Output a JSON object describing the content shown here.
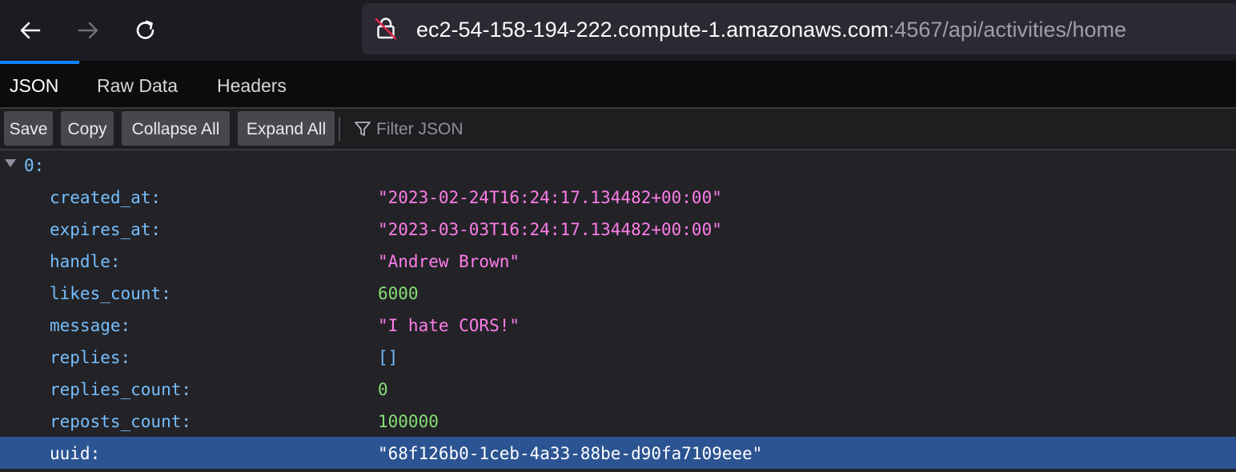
{
  "address_bar": {
    "host": "ec2-54-158-194-222.compute-1.amazonaws.com",
    "path": ":4567/api/activities/home"
  },
  "tabs": [
    {
      "label": "JSON",
      "selected": true
    },
    {
      "label": "Raw Data",
      "selected": false
    },
    {
      "label": "Headers",
      "selected": false
    }
  ],
  "toolbar": {
    "save": "Save",
    "copy": "Copy",
    "collapse_all": "Collapse All",
    "expand_all": "Expand All",
    "filter_placeholder": "Filter JSON"
  },
  "tree": {
    "root_key": "0:",
    "rows": [
      {
        "key": "created_at:",
        "value": "\"2023-02-24T16:24:17.134482+00:00\"",
        "type": "string"
      },
      {
        "key": "expires_at:",
        "value": "\"2023-03-03T16:24:17.134482+00:00\"",
        "type": "string"
      },
      {
        "key": "handle:",
        "value": "\"Andrew Brown\"",
        "type": "string"
      },
      {
        "key": "likes_count:",
        "value": "6000",
        "type": "number"
      },
      {
        "key": "message:",
        "value": "\"I hate CORS!\"",
        "type": "string"
      },
      {
        "key": "replies:",
        "value": "[]",
        "type": "array"
      },
      {
        "key": "replies_count:",
        "value": "0",
        "type": "number"
      },
      {
        "key": "reposts_count:",
        "value": "100000",
        "type": "number"
      },
      {
        "key": "uuid:",
        "value": "\"68f126b0-1ceb-4a33-88be-d90fa7109eee\"",
        "type": "string",
        "selected": true
      }
    ]
  },
  "colors": {
    "key": "#75bfff",
    "string": "#ff7de9",
    "number": "#86de74",
    "selected_row": "#2c5492",
    "tab_indicator": "#0a84ff"
  }
}
